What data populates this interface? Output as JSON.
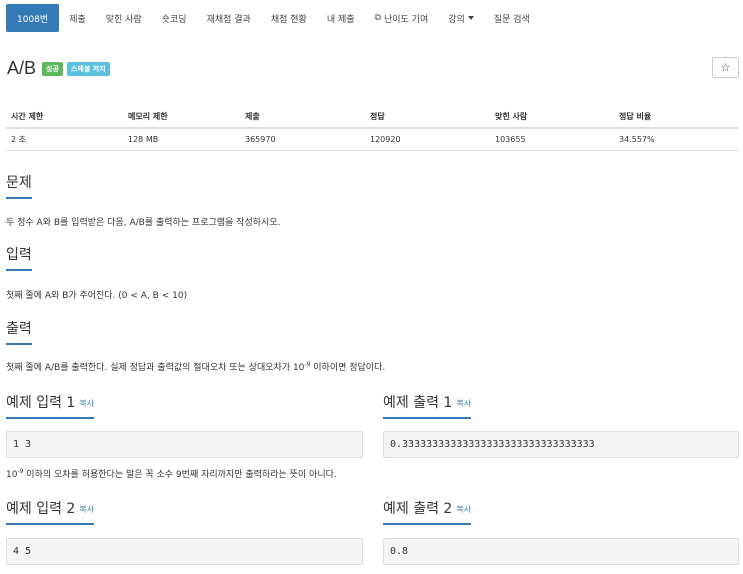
{
  "nav": {
    "tabs": [
      {
        "label": "1008번",
        "active": true
      },
      {
        "label": "제출"
      },
      {
        "label": "맞힌 사람"
      },
      {
        "label": "숏코딩"
      },
      {
        "label": "재채점 결과"
      },
      {
        "label": "채점 현황"
      },
      {
        "label": "내 제출"
      },
      {
        "label": "난이도 기여"
      },
      {
        "label": "강의"
      },
      {
        "label": "질문 검색"
      }
    ]
  },
  "problem": {
    "title": "A/B",
    "badge_success": "성공",
    "badge_special": "스페셜 저지",
    "star": "☆"
  },
  "info": {
    "headers": [
      "시간 제한",
      "메모리 제한",
      "제출",
      "정답",
      "맞힌 사람",
      "정답 비율"
    ],
    "values": [
      "2 초",
      "128 MB",
      "365970",
      "120920",
      "103655",
      "34.557%"
    ]
  },
  "sections": {
    "desc_title": "문제",
    "desc_text": "두 정수 A와 B를 입력받은 다음, A/B를 출력하는 프로그램을 작성하시오.",
    "input_title": "입력",
    "input_text": "첫째 줄에 A와 B가 주어진다. (0 < A, B < 10)",
    "output_title": "출력",
    "output_text_pre": "첫째 줄에 A/B를 출력한다. 실제 정답과 출력값의 절대오차 또는 상대오차가 10",
    "output_text_exp": "-9",
    "output_text_post": " 이하이면 정답이다."
  },
  "samples": {
    "copy_label": "복사",
    "in1_title": "예제 입력 1",
    "out1_title": "예제 출력 1",
    "in1": "1 3",
    "out1": "0.33333333333333333333333333333333",
    "note_pre": "10",
    "note_exp": "-9",
    "note_post": " 이하의 오차를 허용한다는 말은 꼭 소수 9번째 자리까지만 출력하라는 뜻이 아니다.",
    "in2_title": "예제 입력 2",
    "out2_title": "예제 출력 2",
    "in2": "4 5",
    "out2": "0.8"
  }
}
